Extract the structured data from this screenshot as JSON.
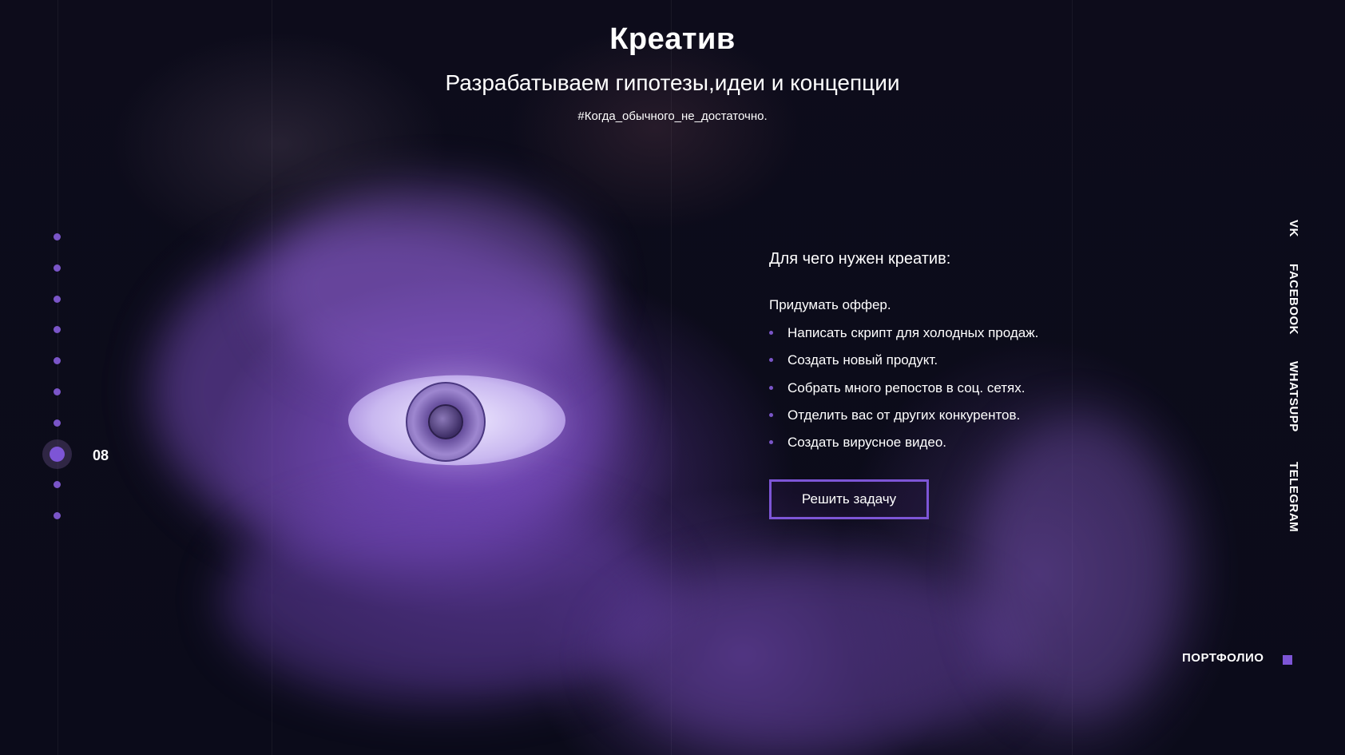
{
  "hero": {
    "title": "Креатив",
    "subtitle": "Разрабатываем гипотезы,идеи и концепции",
    "hashtag": "#Когда_обычного_не_достаточно."
  },
  "why": {
    "heading": "Для чего нужен креатив:",
    "first_item": "Придумать оффер.",
    "items": [
      "Написать скрипт для холодных продаж.",
      "Создать новый продукт.",
      "Собрать много репостов в соц. сетях.",
      "Отделить вас от других конкурентов.",
      "Создать вирусное видео."
    ],
    "button_label": "Решить задачу"
  },
  "pagination": {
    "current": "08"
  },
  "social": {
    "vk": "VK",
    "facebook": "FACEBOOK",
    "whatsapp": "WHATSUPP",
    "telegram": "TELEGRAM"
  },
  "portfolio": {
    "label": "ПОРТФОЛИО"
  },
  "colors": {
    "accent": "#7d55d6",
    "background": "#0b0b1a"
  }
}
